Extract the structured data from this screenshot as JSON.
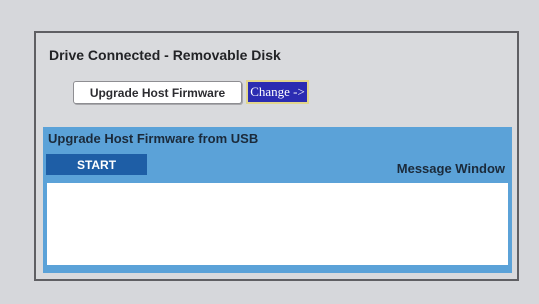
{
  "drive": {
    "status": "Drive Connected - Removable Disk"
  },
  "controls": {
    "upgrade_host_firmware_label": "Upgrade Host Firmware",
    "change_label": "Change ->"
  },
  "usb_section": {
    "header": "Upgrade Host Firmware from USB",
    "start_label": "START",
    "message_window_label": "Message Window",
    "message_text": ""
  },
  "colors": {
    "background": "#d6d7db",
    "panel_border": "#5f5f63",
    "usb_section_bg": "#5ba2d8",
    "start_button_bg": "#1e5ea6",
    "change_button_bg": "#2b2cb2",
    "change_button_border": "#e2d68c"
  }
}
